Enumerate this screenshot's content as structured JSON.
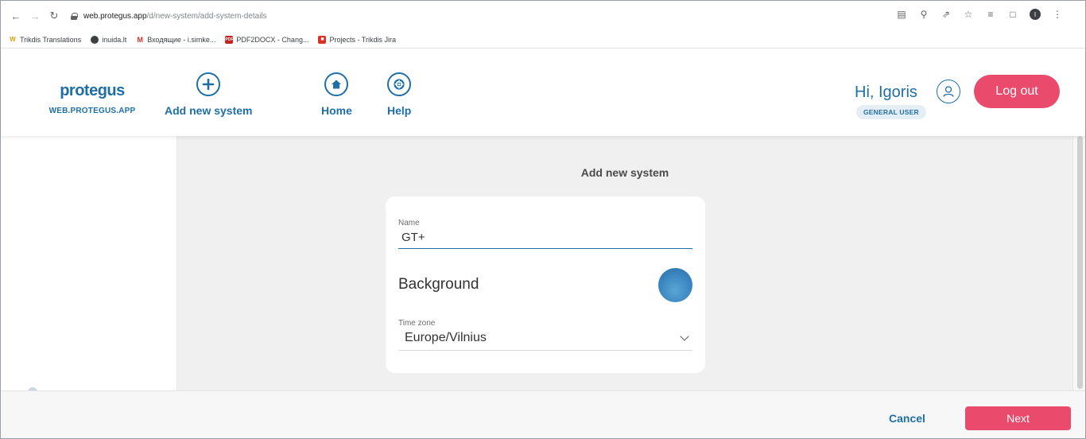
{
  "browser": {
    "url_host": "web.protegus.app",
    "url_path": "/d/new-system/add-system-details",
    "bookmarks": [
      {
        "label": "Trikdis Translations",
        "icon": "wz-icon"
      },
      {
        "label": "inuida.lt",
        "icon": "globe-icon"
      },
      {
        "label": "Входящие - i.simke...",
        "icon": "gmail-icon"
      },
      {
        "label": "PDF2DOCX - Chang...",
        "icon": "pdf-icon"
      },
      {
        "label": "Projects - Trikdis Jira",
        "icon": "jira-icon"
      }
    ],
    "profile_initial": "I"
  },
  "header": {
    "logo": "protegus",
    "logo_subtitle": "WEB.PROTEGUS.APP",
    "nav": [
      {
        "label": "Add new system",
        "icon": "plus-circle-icon"
      },
      {
        "label": "Home",
        "icon": "home-icon"
      },
      {
        "label": "Help",
        "icon": "help-lifebuoy-icon"
      }
    ],
    "greeting": "Hi, Igoris",
    "role": "GENERAL USER",
    "logout_label": "Log out"
  },
  "form": {
    "title": "Add new system",
    "name_label": "Name",
    "name_value": "GT+",
    "background_label": "Background",
    "background_color": "#3a86c0",
    "timezone_label": "Time zone",
    "timezone_value": "Europe/Vilnius"
  },
  "footer": {
    "cancel_label": "Cancel",
    "next_label": "Next"
  },
  "colors": {
    "brand_blue": "#1f6fa6",
    "accent_pink": "#ea4a6c"
  }
}
